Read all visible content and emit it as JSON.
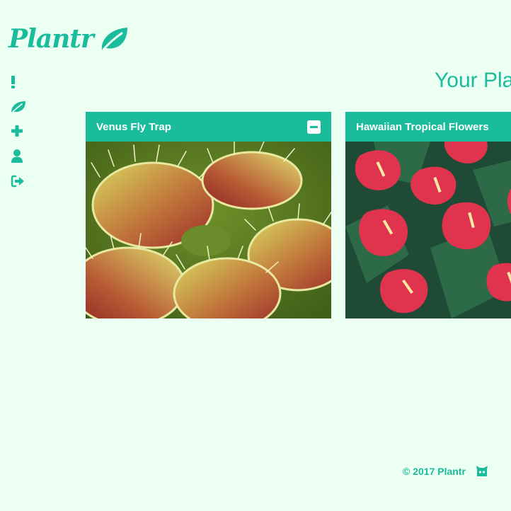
{
  "brand": {
    "name": "Plantr",
    "accent_color": "#1abc9c",
    "background_color": "#ecfff3",
    "logo_icon": "leaf-icon"
  },
  "sidebar": {
    "items": [
      {
        "icon": "exclamation-icon"
      },
      {
        "icon": "leaf-icon"
      },
      {
        "icon": "plus-icon"
      },
      {
        "icon": "user-icon"
      },
      {
        "icon": "sign-out-icon"
      }
    ]
  },
  "main": {
    "title": "Your Pla",
    "cards": [
      {
        "title": "Venus Fly Trap",
        "image": "venus-fly-trap-photo",
        "action_icon": "minus-square-icon"
      },
      {
        "title": "Hawaiian Tropical Flowers",
        "image": "anthurium-flowers-photo"
      }
    ]
  },
  "footer": {
    "copyright": "© 2017 Plantr",
    "icon": "github-icon"
  }
}
